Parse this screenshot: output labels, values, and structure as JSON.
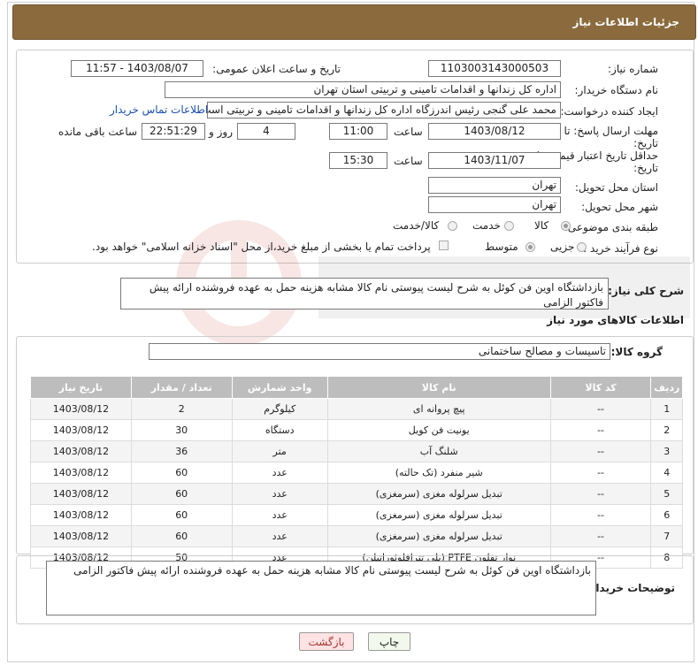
{
  "header": {
    "title": "جزئیات اطلاعات نیاز"
  },
  "info": {
    "need_number_label": "شماره نیاز:",
    "need_number": "1103003143000503",
    "announce_label": "تاریخ و ساعت اعلان عمومی:",
    "announce_value": "1403/08/07 - 11:57",
    "buyer_org_label": "نام دستگاه خریدار:",
    "buyer_org": "اداره کل زندانها و اقدامات تامینی و تربیتی استان تهران",
    "creator_label": "ایجاد کننده درخواست:",
    "creator": "محمد علی گنجی رئیس اندرزگاه  اداره کل زندانها و اقدامات تامینی و تربیتی است",
    "contact_link": "اطلاعات تماس خریدار",
    "deadline_label_1": "مهلت ارسال پاسخ: تا",
    "deadline_label_2": "تاریخ:",
    "deadline_date": "1403/08/12",
    "time_label": "ساعت",
    "deadline_time": "11:00",
    "days": "4",
    "days_label": "روز و",
    "remaining_time": "22:51:29",
    "remaining_label": "ساعت باقی مانده",
    "validity_label_1": "حداقل تاریخ اعتبار قیمت: تا",
    "validity_label_2": "تاریخ:",
    "validity_date": "1403/11/07",
    "validity_time": "15:30",
    "province_label": "استان محل تحویل:",
    "province": "تهران",
    "city_label": "شهر محل تحویل:",
    "city": "تهران",
    "category_label": "طبقه بندی موضوعی:",
    "category_options": [
      "کالا",
      "خدمت",
      "کالا/خدمت"
    ],
    "process_label": "نوع فرآیند خرید :",
    "process_options": [
      "جزیی",
      "متوسط"
    ],
    "payment_note": "پرداخت تمام یا بخشی از مبلغ خرید،از محل \"اسناد خزانه اسلامی\" خواهد بود."
  },
  "description": {
    "label": "شرح کلی نیاز:",
    "text": "بازداشتگاه اوین فن کوئل به شرح لیست پیوستی نام کالا مشابه هزینه حمل به عهده فروشنده ارائه پیش فاکتور الزامی"
  },
  "goods": {
    "section_title": "اطلاعات کالاهای مورد نیاز",
    "group_label": "گروه کالا:",
    "group_value": "تاسیسات و مصالح ساختمانی",
    "columns": [
      "ردیف",
      "کد کالا",
      "نام کالا",
      "واحد شمارش",
      "تعداد / مقدار",
      "تاریخ نیاز"
    ],
    "rows": [
      [
        "1",
        "--",
        "پیچ پروانه ای",
        "کیلوگرم",
        "2",
        "1403/08/12"
      ],
      [
        "2",
        "--",
        "یونیت فن کویل",
        "دستگاه",
        "30",
        "1403/08/12"
      ],
      [
        "3",
        "--",
        "شلنگ آب",
        "متر",
        "36",
        "1403/08/12"
      ],
      [
        "4",
        "--",
        "شیر منفرد (تک حالته)",
        "عدد",
        "60",
        "1403/08/12"
      ],
      [
        "5",
        "--",
        "تبدیل سرلوله مغزی (سرمغزی)",
        "عدد",
        "60",
        "1403/08/12"
      ],
      [
        "6",
        "--",
        "تبدیل سرلوله مغزی (سرمغزی)",
        "عدد",
        "60",
        "1403/08/12"
      ],
      [
        "7",
        "--",
        "تبدیل سرلوله مغزی (سرمغزی)",
        "عدد",
        "60",
        "1403/08/12"
      ],
      [
        "8",
        "--",
        "نوار تفلون PTFE (پلی تترافلوئوراتیلن)",
        "عدد",
        "50",
        "1403/08/12"
      ]
    ]
  },
  "buyer_notes": {
    "label": "توضیحات خریدار:",
    "text": "بازداشتگاه اوین فن کوئل به شرح لیست پیوستی نام کالا مشابه هزینه حمل به عهده فروشنده ارائه پیش فاکتور الزامی"
  },
  "buttons": {
    "print": "چاپ",
    "back": "بازگشت"
  },
  "colors": {
    "header": "#8b6b3d",
    "link": "#1a4fb0",
    "table_header": "#bdbdbd"
  }
}
